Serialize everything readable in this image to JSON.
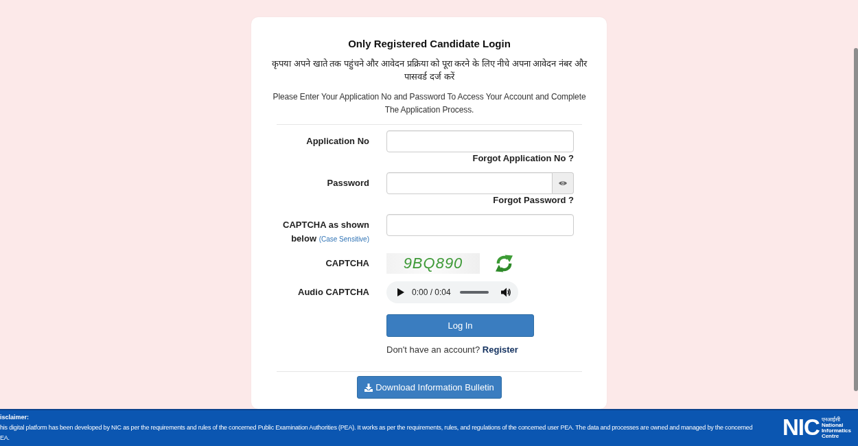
{
  "login": {
    "title": "Only Registered Candidate Login",
    "instructions_hindi": "कृपया अपने खाते तक पहुंचने और आवेदन प्रक्रिया को पूरा करने के लिए नीचे अपना आवेदन नंबर और पासवर्ड दर्ज करें",
    "instructions": "Please Enter Your Application No and Password To Access Your Account and Complete The Application Process."
  },
  "form": {
    "rows": [
      {
        "kind": "text",
        "label": "Application No",
        "link": "Forgot Application No ?"
      },
      {
        "kind": "password",
        "label": "Password",
        "link": "Forgot Password ?"
      },
      {
        "kind": "text",
        "label": "CAPTCHA as shown below",
        "note": "(Case Sensitive)"
      },
      {
        "kind": "captcha",
        "label": "CAPTCHA",
        "code": "9BQ890"
      },
      {
        "kind": "audio",
        "label": "Audio CAPTCHA",
        "time": "0:00 / 0:04"
      }
    ],
    "submit_button": "Log In",
    "register_prompt": "Don't have an account?",
    "register_link": "Register"
  },
  "download_button": "Download Information Bulletin",
  "footer": {
    "heading": "isclaimer:",
    "lines": [
      "his digital platform has been developed by NIC as per the requirements and rules of the concerned Public Examination Authorities (PEA). It works as per the requirements, rules, and regulations of the concerned user PEA. The data and processes are owned and managed by the concerned",
      "EA."
    ],
    "logo": {
      "mark": "NIC",
      "hindi": "एनआईसी",
      "name_lines": [
        "National",
        "Informatics",
        "Centre"
      ]
    }
  }
}
